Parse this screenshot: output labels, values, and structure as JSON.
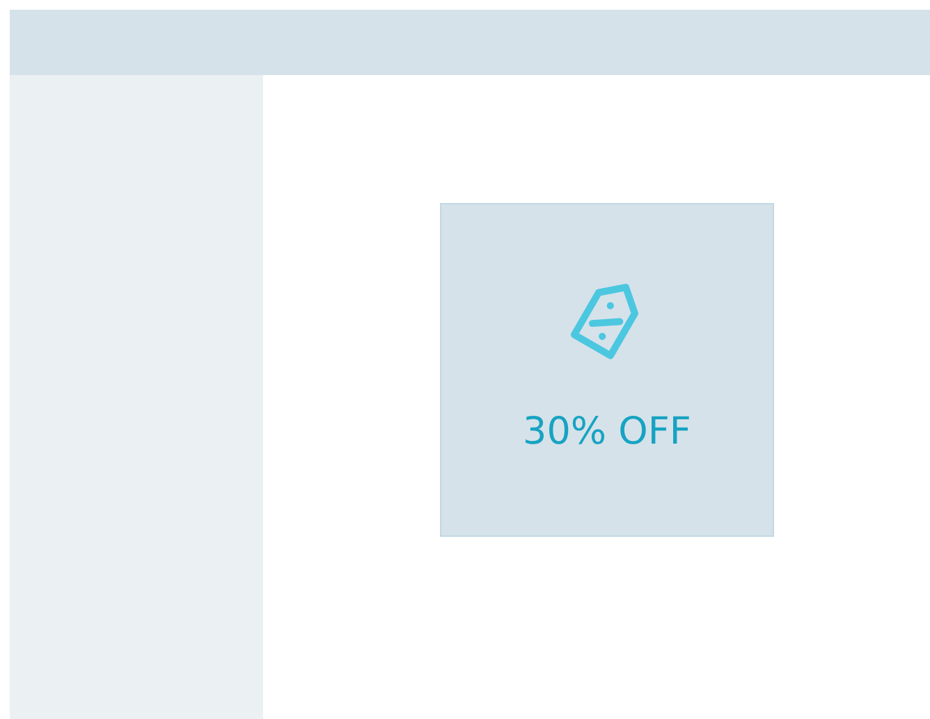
{
  "offer_card": {
    "label": "30% OFF"
  }
}
